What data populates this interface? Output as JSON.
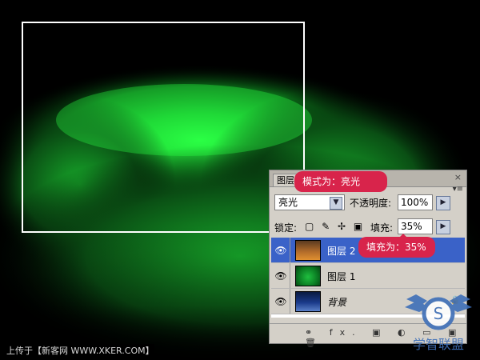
{
  "panel": {
    "tab_label": "图层",
    "close_glyph": "×",
    "menu_glyph": "▾≡",
    "blend_mode": "亮光",
    "opacity_label": "不透明度:",
    "opacity_value": "100%",
    "lock_label": "锁定:",
    "lock_icons": "▢ ✎ ✢ ▣",
    "fill_label": "填充:",
    "fill_value": "35%",
    "layers": [
      {
        "name": "图层 2",
        "thumb": "orange",
        "selected": true
      },
      {
        "name": "图层 1",
        "thumb": "green",
        "selected": false
      },
      {
        "name": "背景",
        "thumb": "blue",
        "selected": false,
        "locked": true
      }
    ],
    "footer_icons": "⚭ fx. ▣ ◐ ▭ ▣ 🗑"
  },
  "callouts": {
    "mode_note": "模式为：亮光",
    "fill_note": "填充为：35%"
  },
  "watermark": "上传于【新客网 WWW.XKER.COM】",
  "logo": {
    "glyph": "S",
    "text": "学智联盟"
  },
  "colors": {
    "selection": "#3a62c8",
    "callout": "#d8244b",
    "panel_bg": "#d4d0c8"
  },
  "icons": {
    "eye": "eye-icon",
    "lock": "lock-icon",
    "dropdown": "chevron-down-icon",
    "stepper": "chevron-right-icon"
  }
}
